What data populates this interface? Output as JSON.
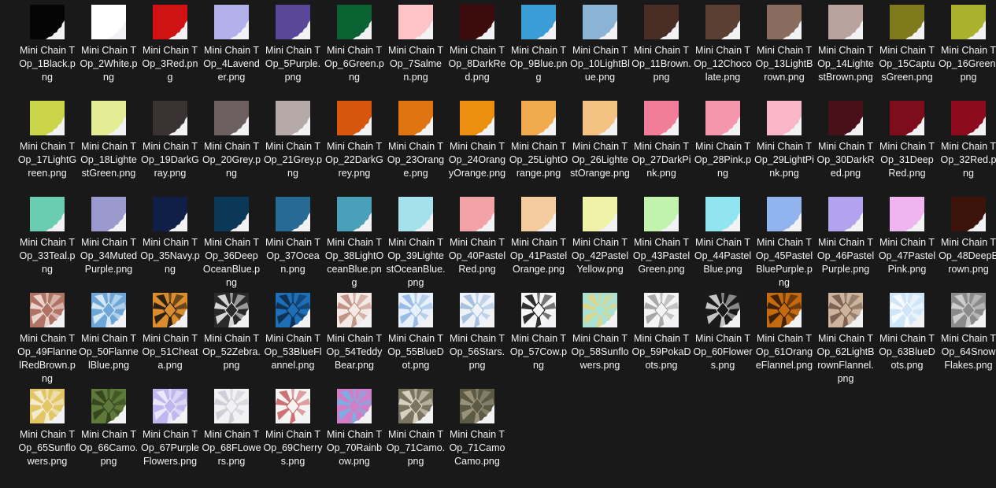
{
  "files": [
    {
      "name": "Mini Chain TOp_1Black.png",
      "swatch": "#050505",
      "icon": "solid-swatch-thumbnail"
    },
    {
      "name": "Mini Chain TOp_2White.png",
      "swatch": "#ffffff",
      "icon": "solid-swatch-thumbnail"
    },
    {
      "name": "Mini Chain TOp_3Red.png",
      "swatch": "#d01213",
      "icon": "solid-swatch-thumbnail"
    },
    {
      "name": "Mini Chain TOp_4Lavender.png",
      "swatch": "#b2b1ec",
      "icon": "solid-swatch-thumbnail"
    },
    {
      "name": "Mini Chain TOp_5Purple.png",
      "swatch": "#5b479a",
      "icon": "solid-swatch-thumbnail"
    },
    {
      "name": "Mini Chain TOp_6Green.png",
      "swatch": "#0a6232",
      "icon": "solid-swatch-thumbnail"
    },
    {
      "name": "Mini Chain TOp_7Salmen.png",
      "swatch": "#fdc3c7",
      "icon": "solid-swatch-thumbnail"
    },
    {
      "name": "Mini Chain TOp_8DarkRed.png",
      "swatch": "#3d0b0b",
      "icon": "solid-swatch-thumbnail"
    },
    {
      "name": "Mini Chain TOp_9Blue.png",
      "swatch": "#3b9dd6",
      "icon": "solid-swatch-thumbnail"
    },
    {
      "name": "Mini Chain TOp_10LightBlue.png",
      "swatch": "#8ab3d6",
      "icon": "solid-swatch-thumbnail"
    },
    {
      "name": "Mini Chain TOp_11Brown.png",
      "swatch": "#4a2e26",
      "icon": "solid-swatch-thumbnail"
    },
    {
      "name": "Mini Chain TOp_12Chocolate.png",
      "swatch": "#5b3f33",
      "icon": "solid-swatch-thumbnail"
    },
    {
      "name": "Mini Chain TOp_13LightBrown.png",
      "swatch": "#8a6c5e",
      "icon": "solid-swatch-thumbnail"
    },
    {
      "name": "Mini Chain TOp_14LightestBrown.png",
      "swatch": "#baa39c",
      "icon": "solid-swatch-thumbnail"
    },
    {
      "name": "Mini Chain TOp_15CaptusGreen.png",
      "swatch": "#7f7a1c",
      "icon": "solid-swatch-thumbnail"
    },
    {
      "name": "Mini Chain TOp_16Green.png",
      "swatch": "#aab22d",
      "icon": "solid-swatch-thumbnail"
    },
    {
      "name": "Mini Chain TOp_17LightGreen.png",
      "swatch": "#cbd549",
      "icon": "solid-swatch-thumbnail"
    },
    {
      "name": "Mini Chain TOp_18LightestGreen.png",
      "swatch": "#e4ec94",
      "icon": "solid-swatch-thumbnail"
    },
    {
      "name": "Mini Chain TOp_19DarkGray.png",
      "swatch": "#3a3233",
      "icon": "solid-swatch-thumbnail"
    },
    {
      "name": "Mini Chain TOp_20Grey.png",
      "swatch": "#6c6160",
      "icon": "solid-swatch-thumbnail"
    },
    {
      "name": "Mini Chain TOp_21Grey.png",
      "swatch": "#b5aaa8",
      "icon": "solid-swatch-thumbnail"
    },
    {
      "name": "Mini Chain TOp_22DarkGrey.png",
      "swatch": "#d6560d",
      "icon": "solid-swatch-thumbnail"
    },
    {
      "name": "Mini Chain TOp_23Orange.png",
      "swatch": "#e07410",
      "icon": "solid-swatch-thumbnail"
    },
    {
      "name": "Mini Chain TOp_24OrangyOrange.png",
      "swatch": "#ec8f10",
      "icon": "solid-swatch-thumbnail"
    },
    {
      "name": "Mini Chain TOp_25LightOrange.png",
      "swatch": "#f1ab4e",
      "icon": "solid-swatch-thumbnail"
    },
    {
      "name": "Mini Chain TOp_26LightestOrange.png",
      "swatch": "#f4c384",
      "icon": "solid-swatch-thumbnail"
    },
    {
      "name": "Mini Chain TOp_27DarkPink.png",
      "swatch": "#f17d98",
      "icon": "solid-swatch-thumbnail"
    },
    {
      "name": "Mini Chain TOp_28Pink.png",
      "swatch": "#f596ad",
      "icon": "solid-swatch-thumbnail"
    },
    {
      "name": "Mini Chain TOp_29LightPink.png",
      "swatch": "#f8b6c7",
      "icon": "solid-swatch-thumbnail"
    },
    {
      "name": "Mini Chain TOp_30DarkRed.png",
      "swatch": "#48111a",
      "icon": "solid-swatch-thumbnail"
    },
    {
      "name": "Mini Chain TOp_31DeepRed.png",
      "swatch": "#7d0d1a",
      "icon": "solid-swatch-thumbnail"
    },
    {
      "name": "Mini Chain TOp_32Red.png",
      "swatch": "#8d0b1c",
      "icon": "solid-swatch-thumbnail"
    },
    {
      "name": "Mini Chain TOp_33Teal.png",
      "swatch": "#6acdb2",
      "icon": "solid-swatch-thumbnail"
    },
    {
      "name": "Mini Chain TOp_34MutedPurple.png",
      "swatch": "#9b9acf",
      "icon": "solid-swatch-thumbnail"
    },
    {
      "name": "Mini Chain TOp_35Navy.png",
      "swatch": "#0f1f45",
      "icon": "solid-swatch-thumbnail"
    },
    {
      "name": "Mini Chain TOp_36DeepOceanBlue.png",
      "swatch": "#0c3857",
      "icon": "solid-swatch-thumbnail"
    },
    {
      "name": "Mini Chain TOp_37Ocean.png",
      "swatch": "#276b94",
      "icon": "solid-swatch-thumbnail"
    },
    {
      "name": "Mini Chain TOp_38LightOceanBlue.png",
      "swatch": "#4aa0b9",
      "icon": "solid-swatch-thumbnail"
    },
    {
      "name": "Mini Chain TOp_39LightestOceanBlue.png",
      "swatch": "#a4e1eb",
      "icon": "solid-swatch-thumbnail"
    },
    {
      "name": "Mini Chain TOp_40PastelRed.png",
      "swatch": "#f3a2a5",
      "icon": "solid-swatch-thumbnail"
    },
    {
      "name": "Mini Chain TOp_41PastelOrange.png",
      "swatch": "#f5cc9e",
      "icon": "solid-swatch-thumbnail"
    },
    {
      "name": "Mini Chain TOp_42PastelYellow.png",
      "swatch": "#f1f2aa",
      "icon": "solid-swatch-thumbnail"
    },
    {
      "name": "Mini Chain TOp_43PastelGreen.png",
      "swatch": "#c1f2ae",
      "icon": "solid-swatch-thumbnail"
    },
    {
      "name": "Mini Chain TOp_44PastelBlue.png",
      "swatch": "#91e5f0",
      "icon": "solid-swatch-thumbnail"
    },
    {
      "name": "Mini Chain TOp_45PastelBluePurple.png",
      "swatch": "#92b4ee",
      "icon": "solid-swatch-thumbnail"
    },
    {
      "name": "Mini Chain TOp_46PastelPurple.png",
      "swatch": "#b3a3ef",
      "icon": "solid-swatch-thumbnail"
    },
    {
      "name": "Mini Chain TOp_47PastelPink.png",
      "swatch": "#f0b4f0",
      "icon": "solid-swatch-thumbnail"
    },
    {
      "name": "Mini Chain TOp_48DeepBrown.png",
      "swatch": "#3b1308",
      "icon": "solid-swatch-thumbnail"
    },
    {
      "name": "Mini Chain TOp_49FlannelRedBrown.png",
      "swatch": "#b07466",
      "accent": "#f5e6e0",
      "icon": "patterned-fabric-thumbnail"
    },
    {
      "name": "Mini Chain TOp_50FlannelBlue.png",
      "swatch": "#6ea7d7",
      "accent": "#e9f3fb",
      "icon": "patterned-fabric-thumbnail"
    },
    {
      "name": "Mini Chain TOp_51Cheata.png",
      "swatch": "#d98d2f",
      "accent": "#0d0d0d",
      "icon": "patterned-fabric-thumbnail"
    },
    {
      "name": "Mini Chain TOp_52Zebra.png",
      "swatch": "#2a2a2a",
      "accent": "#f4f4f4",
      "icon": "patterned-fabric-thumbnail"
    },
    {
      "name": "Mini Chain TOp_53BlueFlannel.png",
      "swatch": "#1d6fb8",
      "accent": "#0e2740",
      "icon": "patterned-fabric-thumbnail"
    },
    {
      "name": "Mini Chain TOp_54TeddyBear.png",
      "swatch": "#f4e9e4",
      "accent": "#b98577",
      "icon": "patterned-fabric-thumbnail"
    },
    {
      "name": "Mini Chain TOp_55BlueDot.png",
      "swatch": "#e8f1fb",
      "accent": "#8cb4e0",
      "icon": "patterned-fabric-thumbnail"
    },
    {
      "name": "Mini Chain TOp_56Stars.png",
      "swatch": "#eef3fa",
      "accent": "#9bb8d8",
      "icon": "patterned-fabric-thumbnail"
    },
    {
      "name": "Mini Chain TOp_57Cow.png",
      "swatch": "#f6f6f6",
      "accent": "#0b0b0b",
      "icon": "patterned-fabric-thumbnail"
    },
    {
      "name": "Mini Chain TOp_58Sunflowers.png",
      "swatch": "#a9e2d3",
      "accent": "#e8d37a",
      "icon": "patterned-fabric-thumbnail"
    },
    {
      "name": "Mini Chain TOp_59PokaDots.png",
      "swatch": "#f4f4f4",
      "accent": "#9a9a9a",
      "icon": "patterned-fabric-thumbnail"
    },
    {
      "name": "Mini Chain TOp_60Flowers.png",
      "swatch": "#1a1a1a",
      "accent": "#e4e4e4",
      "icon": "patterned-fabric-thumbnail"
    },
    {
      "name": "Mini Chain TOp_61OrangeFlannel.png",
      "swatch": "#c46a10",
      "accent": "#2a1505",
      "icon": "patterned-fabric-thumbnail"
    },
    {
      "name": "Mini Chain TOp_62LightBrownFlannel.png",
      "swatch": "#cdb49f",
      "accent": "#6e5646",
      "icon": "patterned-fabric-thumbnail"
    },
    {
      "name": "Mini Chain TOp_63BlueDots.png",
      "swatch": "#cfe5f8",
      "accent": "#ffffff",
      "icon": "patterned-fabric-thumbnail"
    },
    {
      "name": "Mini Chain TOp_64SnowFlakes.png",
      "swatch": "#8b8b8b",
      "accent": "#d8d8d8",
      "icon": "patterned-fabric-thumbnail"
    },
    {
      "name": "Mini Chain TOp_65Sunflowers.png",
      "swatch": "#e2c564",
      "accent": "#f5f1e2",
      "icon": "patterned-fabric-thumbnail"
    },
    {
      "name": "Mini Chain TOp_66Camo.png",
      "swatch": "#5e7a3a",
      "accent": "#2f3d1b",
      "icon": "patterned-fabric-thumbnail"
    },
    {
      "name": "Mini Chain TOp_67PurpleFlowers.png",
      "swatch": "#c0b7ee",
      "accent": "#f3f1fd",
      "icon": "patterned-fabric-thumbnail"
    },
    {
      "name": "Mini Chain TOp_68FLowers.png",
      "swatch": "#f2f2f4",
      "accent": "#c9c9d2",
      "icon": "patterned-fabric-thumbnail"
    },
    {
      "name": "Mini Chain TOp_69Cherrys.png",
      "swatch": "#f6f3f3",
      "accent": "#c45a5a",
      "icon": "patterned-fabric-thumbnail"
    },
    {
      "name": "Mini Chain TOp_70Rainbow.png",
      "swatch": "#d27ec6",
      "accent": "#6fb6e8",
      "icon": "patterned-fabric-thumbnail"
    },
    {
      "name": "Mini Chain TOp_71Camo.png",
      "swatch": "#7b7460",
      "accent": "#e6e1d2",
      "icon": "patterned-fabric-thumbnail"
    },
    {
      "name": "Mini Chain TOp_71CamoCamo.png",
      "swatch": "#5c5a45",
      "accent": "#a39c83",
      "icon": "patterned-fabric-thumbnail"
    }
  ]
}
